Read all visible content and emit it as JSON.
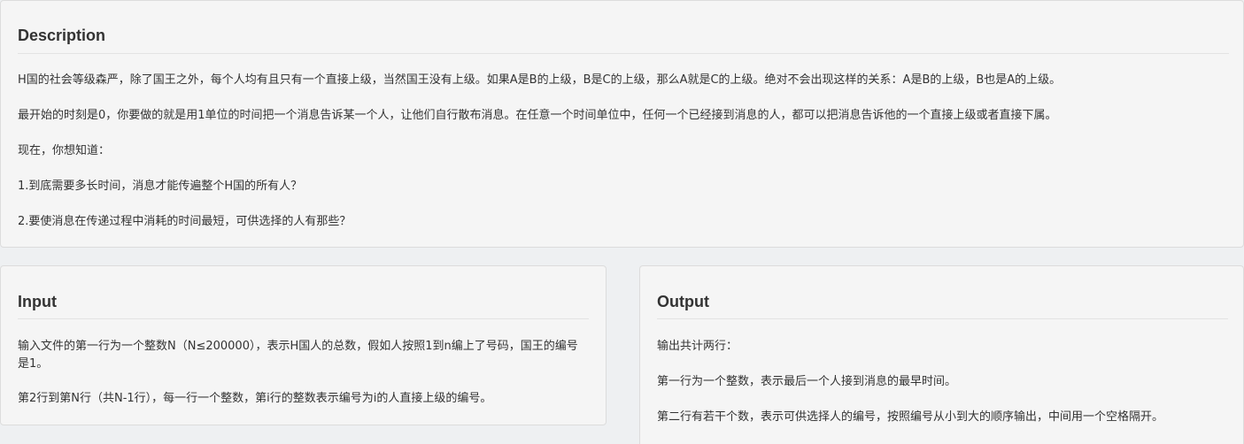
{
  "description": {
    "title": "Description",
    "paragraphs": [
      "H国的社会等级森严，除了国王之外，每个人均有且只有一个直接上级，当然国王没有上级。如果A是B的上级，B是C的上级，那么A就是C的上级。绝对不会出现这样的关系：A是B的上级，B也是A的上级。",
      "最开始的时刻是0，你要做的就是用1单位的时间把一个消息告诉某一个人，让他们自行散布消息。在任意一个时间单位中，任何一个已经接到消息的人，都可以把消息告诉他的一个直接上级或者直接下属。",
      "现在，你想知道：",
      "1.到底需要多长时间，消息才能传遍整个H国的所有人？",
      "2.要使消息在传递过程中消耗的时间最短，可供选择的人有那些？"
    ]
  },
  "input": {
    "title": "Input",
    "paragraphs": [
      "输入文件的第一行为一个整数N（N≤200000），表示H国人的总数，假如人按照1到n编上了号码，国王的编号是1。",
      "第2行到第N行（共N-1行），每一行一个整数，第i行的整数表示编号为i的人直接上级的编号。"
    ]
  },
  "output": {
    "title": "Output",
    "paragraphs": [
      "输出共计两行：",
      "第一行为一个整数，表示最后一个人接到消息的最早时间。",
      "第二行有若干个数，表示可供选择人的编号，按照编号从小到大的顺序输出，中间用一个空格隔开。"
    ]
  }
}
